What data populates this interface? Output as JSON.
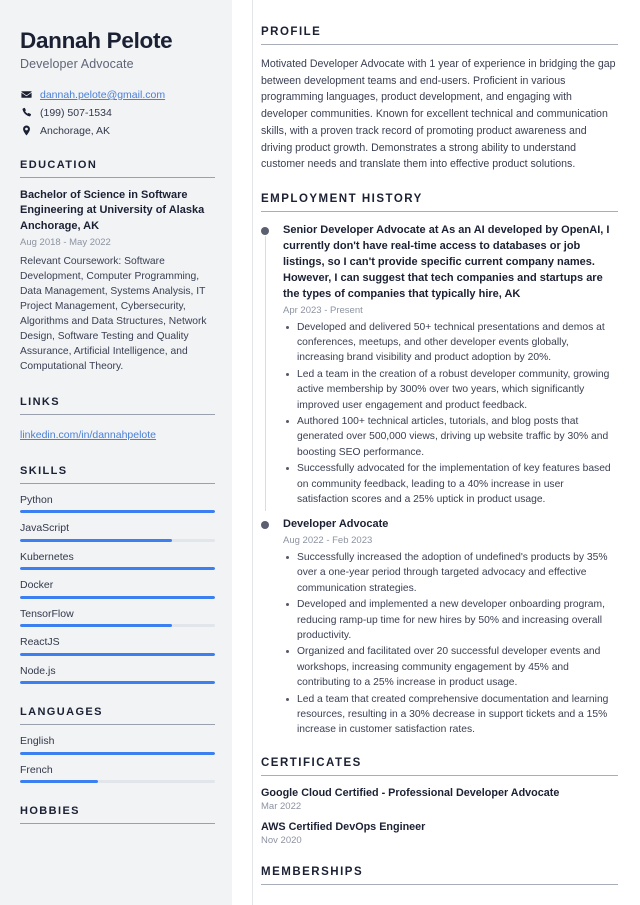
{
  "theme": {
    "accent": "#3b7ff0",
    "link": "#4a7fd4",
    "heading": "#1b2033",
    "muted": "#8d93a1",
    "sidebar_bg": "#f1f3f5"
  },
  "header": {
    "name": "Dannah Pelote",
    "job_title": "Developer Advocate",
    "contacts": [
      {
        "icon": "envelope-icon",
        "text": "dannah.pelote@gmail.com",
        "is_link": true
      },
      {
        "icon": "phone-icon",
        "text": "(199) 507-1534",
        "is_link": false
      },
      {
        "icon": "map-pin-icon",
        "text": "Anchorage, AK",
        "is_link": false
      }
    ]
  },
  "sidebar": {
    "education": {
      "heading": "EDUCATION",
      "degree": "Bachelor of Science in Software Engineering at University of Alaska Anchorage, AK",
      "date": "Aug 2018 - May 2022",
      "description": "Relevant Coursework: Software Development, Computer Programming, Data Management, Systems Analysis, IT Project Management, Cybersecurity, Algorithms and Data Structures, Network Design, Software Testing and Quality Assurance, Artificial Intelligence, and Computational Theory."
    },
    "links": {
      "heading": "LINKS",
      "items": [
        {
          "label": "linkedin.com/in/dannahpelote"
        }
      ]
    },
    "skills": {
      "heading": "SKILLS",
      "items": [
        {
          "label": "Python",
          "level": 100
        },
        {
          "label": "JavaScript",
          "level": 78
        },
        {
          "label": "Kubernetes",
          "level": 100
        },
        {
          "label": "Docker",
          "level": 100
        },
        {
          "label": "TensorFlow",
          "level": 78
        },
        {
          "label": "ReactJS",
          "level": 100
        },
        {
          "label": "Node.js",
          "level": 100
        }
      ]
    },
    "languages": {
      "heading": "LANGUAGES",
      "items": [
        {
          "label": "English",
          "level": 100
        },
        {
          "label": "French",
          "level": 40
        }
      ]
    },
    "hobbies": {
      "heading": "HOBBIES"
    }
  },
  "main": {
    "profile": {
      "heading": "PROFILE",
      "text": "Motivated Developer Advocate with 1 year of experience in bridging the gap between development teams and end-users. Proficient in various programming languages, product development, and engaging with developer communities. Known for excellent technical and communication skills, with a proven track record of promoting product awareness and driving product growth. Demonstrates a strong ability to understand customer needs and translate them into effective product solutions."
    },
    "employment": {
      "heading": "EMPLOYMENT HISTORY",
      "jobs": [
        {
          "title": "Senior Developer Advocate at As an AI developed by OpenAI, I currently don't have real-time access to databases or job listings, so I can't provide specific current company names. However, I can suggest that tech companies and startups are the types of companies that typically hire, AK",
          "date": "Apr 2023 - Present",
          "bullets": [
            "Developed and delivered 50+ technical presentations and demos at conferences, meetups, and other developer events globally, increasing brand visibility and product adoption by 20%.",
            "Led a team in the creation of a robust developer community, growing active membership by 300% over two years, which significantly improved user engagement and product feedback.",
            "Authored 100+ technical articles, tutorials, and blog posts that generated over 500,000 views, driving up website traffic by 30% and boosting SEO performance.",
            "Successfully advocated for the implementation of key features based on community feedback, leading to a 40% increase in user satisfaction scores and a 25% uptick in product usage."
          ]
        },
        {
          "title": "Developer Advocate",
          "date": "Aug 2022 - Feb 2023",
          "bullets": [
            "Successfully increased the adoption of undefined's products by 35% over a one-year period through targeted advocacy and effective communication strategies.",
            "Developed and implemented a new developer onboarding program, reducing ramp-up time for new hires by 50% and increasing overall productivity.",
            "Organized and facilitated over 20 successful developer events and workshops, increasing community engagement by 45% and contributing to a 25% increase in product usage.",
            "Led a team that created comprehensive documentation and learning resources, resulting in a 30% decrease in support tickets and a 15% increase in customer satisfaction rates."
          ]
        }
      ]
    },
    "certificates": {
      "heading": "CERTIFICATES",
      "items": [
        {
          "name": "Google Cloud Certified - Professional Developer Advocate",
          "date": "Mar 2022"
        },
        {
          "name": "AWS Certified DevOps Engineer",
          "date": "Nov 2020"
        }
      ]
    },
    "memberships": {
      "heading": "MEMBERSHIPS"
    }
  }
}
